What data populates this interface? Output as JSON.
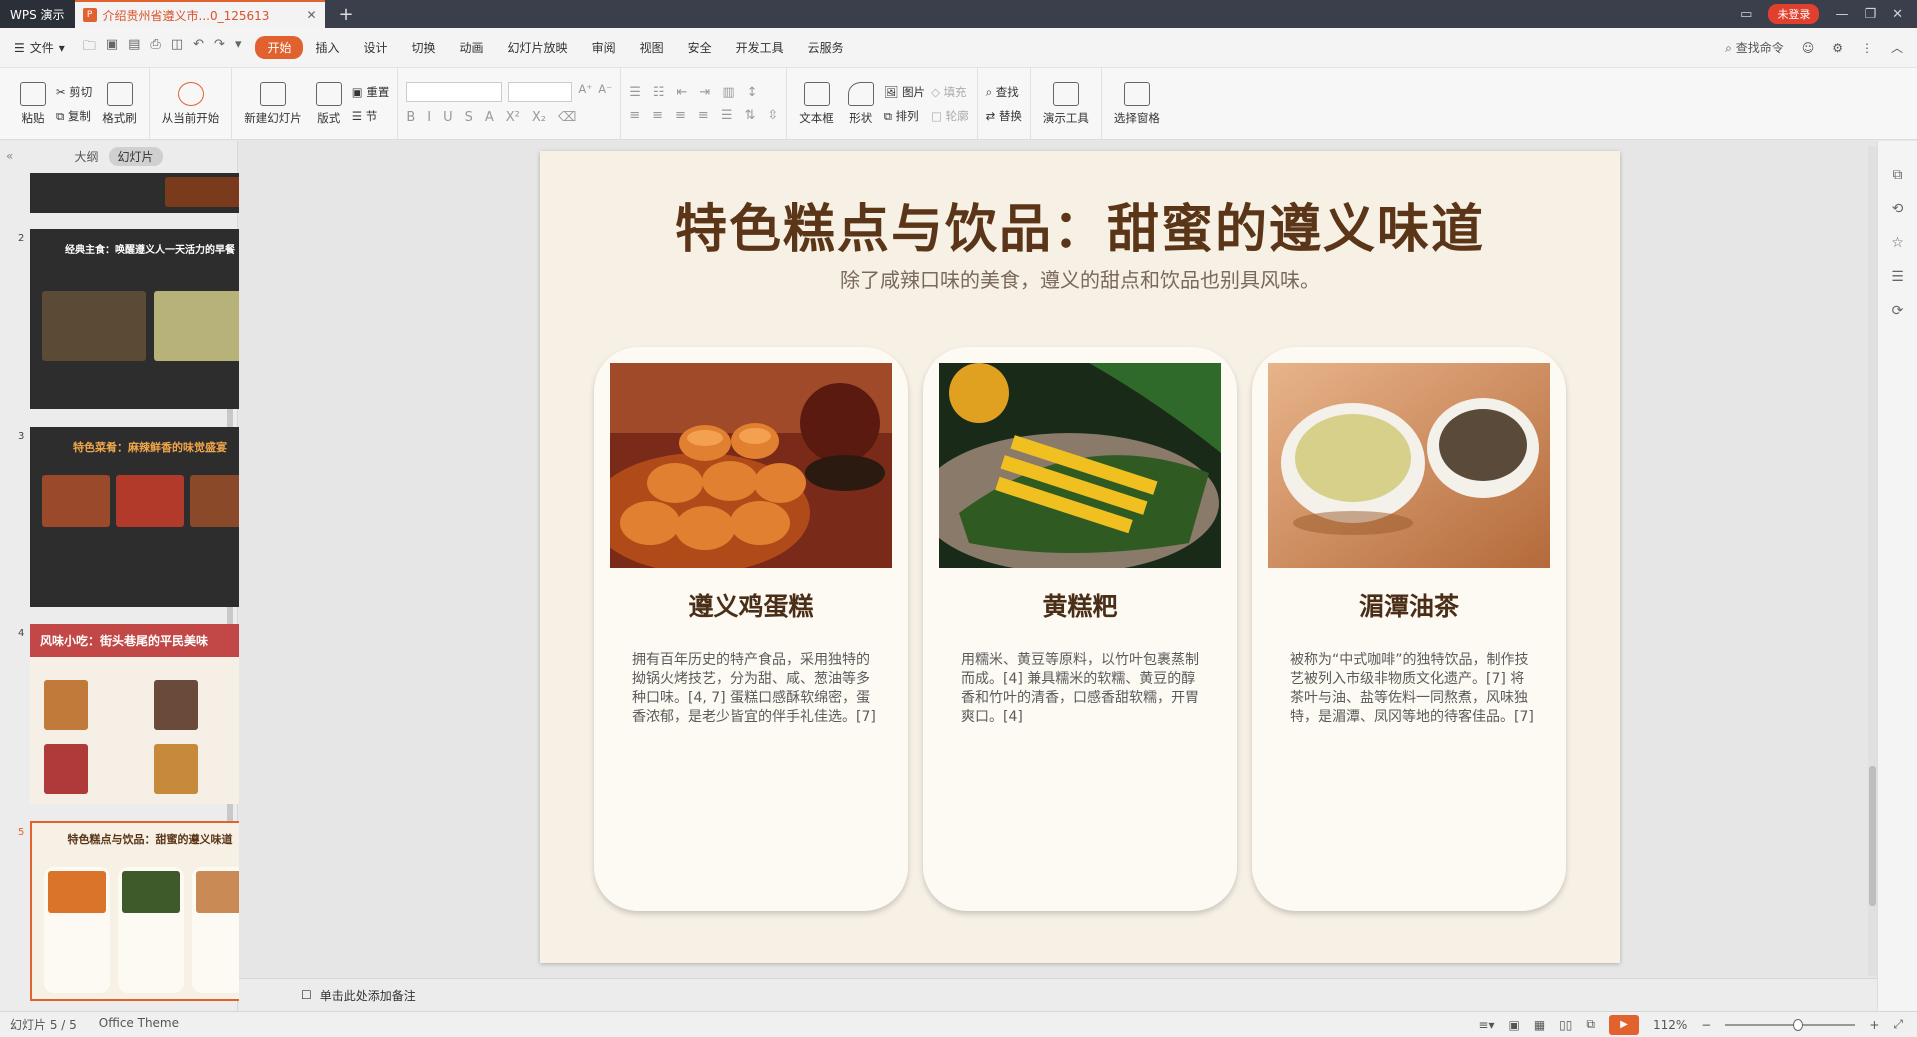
{
  "titlebar": {
    "app_tab": "WPS 演示",
    "doc_tab": "介绍贵州省遵义市...0_125613",
    "login": "未登录"
  },
  "menubar": {
    "file": "文件",
    "tabs": [
      "开始",
      "插入",
      "设计",
      "切换",
      "动画",
      "幻灯片放映",
      "审阅",
      "视图",
      "安全",
      "开发工具",
      "云服务"
    ],
    "active_tab": "开始",
    "search": "查找命令"
  },
  "ribbon": {
    "paste": "粘贴",
    "cut": "剪切",
    "copy": "复制",
    "format_painter": "格式刷",
    "play_from_current": "从当前开始",
    "new_slide": "新建幻灯片",
    "layout": "版式",
    "reset": "重置",
    "section": "节",
    "textbox": "文本框",
    "shape": "形状",
    "picture": "图片",
    "arrange": "排列",
    "fill": "填充",
    "outline": "轮廓",
    "find": "查找",
    "replace": "替换",
    "present_tools": "演示工具",
    "selection_pane": "选择窗格"
  },
  "left_panel": {
    "tab_outline": "大纲",
    "tab_slides": "幻灯片",
    "thumbs": [
      {
        "num": "2",
        "title": "经典主食：唤醒遵义人一天活力的早餐"
      },
      {
        "num": "3",
        "title": "特色菜肴：麻辣鲜香的味觉盛宴"
      },
      {
        "num": "4",
        "title": "风味小吃：街头巷尾的平民美味"
      },
      {
        "num": "5",
        "title": "特色糕点与饮品：甜蜜的遵义味道"
      }
    ]
  },
  "slide": {
    "title": "特色糕点与饮品：甜蜜的遵义味道",
    "subtitle": "除了咸辣口味的美食，遵义的甜点和饮品也别具风味。",
    "cards": [
      {
        "title": "遵义鸡蛋糕",
        "body": "拥有百年历史的特产食品，采用独特的拗锅火烤技艺，分为甜、咸、葱油等多种口味。[4, 7] 蛋糕口感酥软绵密，蛋香浓郁，是老少皆宜的伴手礼佳选。[7]"
      },
      {
        "title": "黄糕粑",
        "body": "用糯米、黄豆等原料，以竹叶包裹蒸制而成。[4] 兼具糯米的软糯、黄豆的醇香和竹叶的清香，口感香甜软糯，开胃爽口。[4]"
      },
      {
        "title": "湄潭油茶",
        "body": "被称为“中式咖啡”的独特饮品，制作技艺被列入市级非物质文化遗产。[7] 将茶叶与油、盐等佐料一同熬煮，风味独特，是湄潭、凤冈等地的待客佳品。[7]"
      }
    ]
  },
  "notes": {
    "placeholder": "单击此处添加备注"
  },
  "statusbar": {
    "slide_count": "幻灯片 5 / 5",
    "theme": "Office Theme",
    "zoom": "112%"
  },
  "colors": {
    "accent": "#e2622f",
    "title_brown": "#5b3518",
    "slide_bg": "#f6f0e5"
  }
}
